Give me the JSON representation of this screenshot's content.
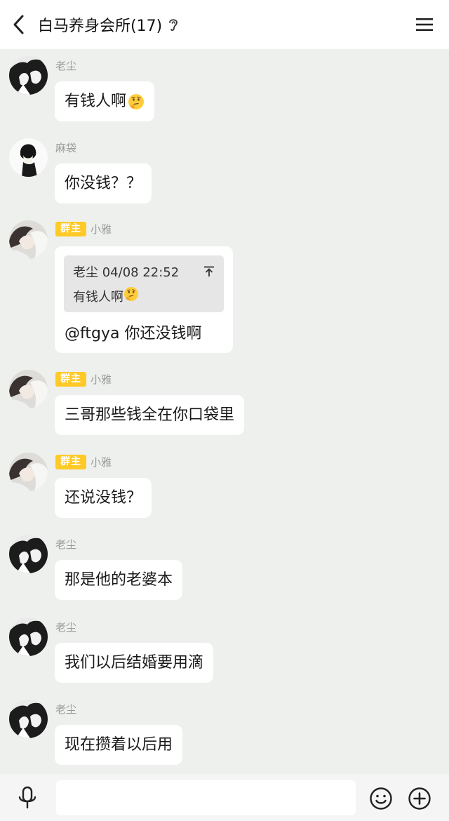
{
  "header": {
    "back_icon": "chevron-left-icon",
    "title": "白马养身会所(17)",
    "ear_icon": "ear-icon",
    "menu_icon": "hamburger-menu-icon"
  },
  "messages": [
    {
      "sender": "老尘",
      "badge": "",
      "text": "有钱人啊",
      "emoji": "thinking-face",
      "avatar": "avatar-laochen"
    },
    {
      "sender": "麻袋",
      "badge": "",
      "text": "你没钱？？",
      "avatar": "avatar-madai"
    },
    {
      "sender": "小雅",
      "badge": "群主",
      "avatar": "avatar-xiaoya",
      "quote": {
        "author": "老尘",
        "time": "04/08 22:52",
        "text": "有钱人啊",
        "emoji": "thinking-face"
      },
      "text": "@ftgya 你还没钱啊"
    },
    {
      "sender": "小雅",
      "badge": "群主",
      "text": "三哥那些钱全在你口袋里",
      "avatar": "avatar-xiaoya"
    },
    {
      "sender": "小雅",
      "badge": "群主",
      "text": "还说没钱？",
      "avatar": "avatar-xiaoya"
    },
    {
      "sender": "老尘",
      "badge": "",
      "text": "那是他的老婆本",
      "avatar": "avatar-laochen"
    },
    {
      "sender": "老尘",
      "badge": "",
      "text": "我们以后结婚要用滴",
      "avatar": "avatar-laochen"
    },
    {
      "sender": "老尘",
      "badge": "",
      "text": "现在攒着以后用",
      "avatar": "avatar-laochen"
    }
  ],
  "input_bar": {
    "mic_icon": "microphone-icon",
    "placeholder": "",
    "emoji_icon": "smiley-icon",
    "plus_icon": "plus-circle-icon"
  },
  "colors": {
    "background": "#edf0ec",
    "badge": "#ffc928",
    "bubble": "#ffffff"
  }
}
